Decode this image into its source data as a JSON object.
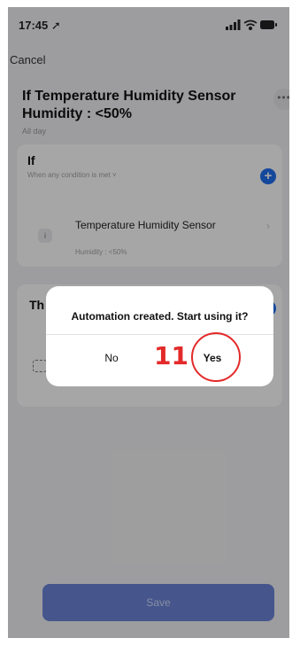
{
  "status_bar": {
    "time": "17:45 ➚"
  },
  "nav": {
    "cancel_label": "Cancel"
  },
  "automation": {
    "title": "If Temperature Humidity Sensor Humidity : <50%",
    "schedule": "All day",
    "more_label": "•••"
  },
  "if_section": {
    "label": "If",
    "condition_mode": "When any condition is met ˅",
    "add_label": "+",
    "condition": {
      "title": "Temperature Humidity Sensor",
      "detail": "Humidity : <50%",
      "icon_label": "i",
      "chevron": "›"
    }
  },
  "then_section": {
    "label": "Th",
    "add_label": "+",
    "chevron": "›"
  },
  "dialog": {
    "message": "Automation created. Start using it?",
    "no_label": "No",
    "yes_label": "Yes"
  },
  "annotation": {
    "step_number": "11",
    "color": "#e32a29"
  },
  "footer": {
    "save_label": "Save"
  },
  "colors": {
    "accent": "#1f6ff0",
    "save_button": "#6c84d9"
  }
}
